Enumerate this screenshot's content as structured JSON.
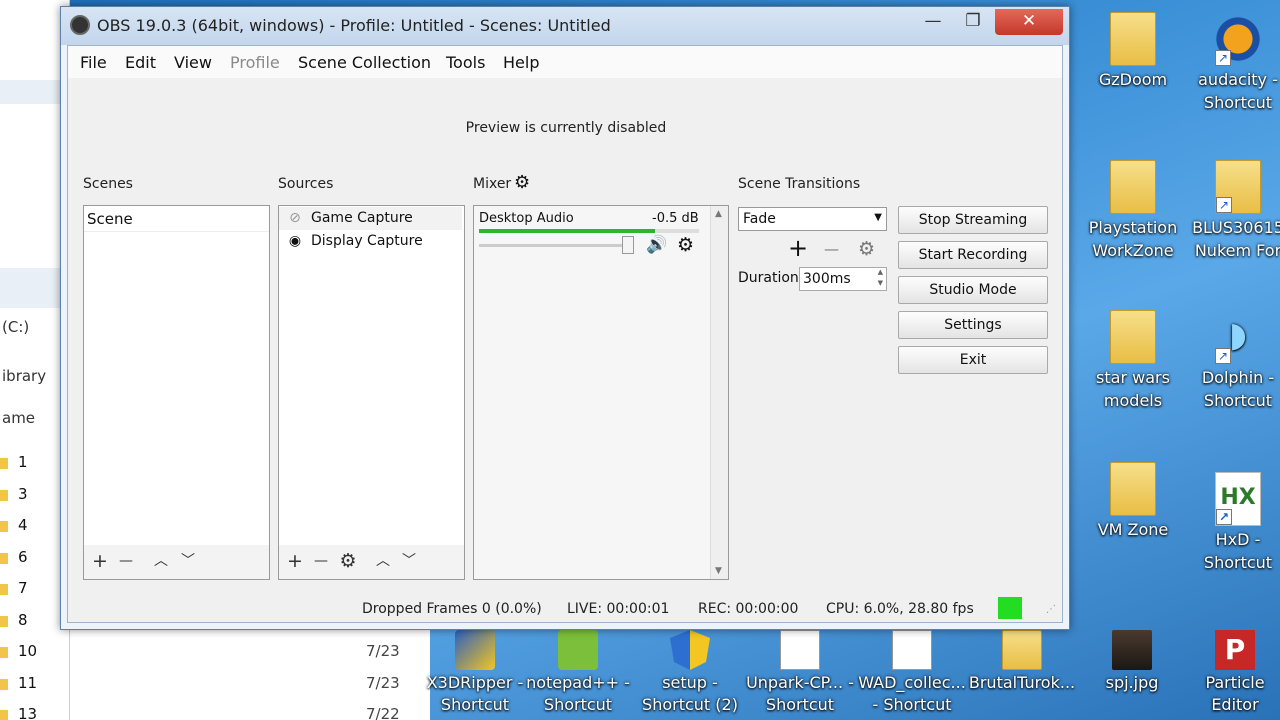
{
  "window": {
    "title": "OBS 19.0.3 (64bit, windows) - Profile: Untitled - Scenes: Untitled",
    "controls": {
      "minimize": "—",
      "maximize": "❐",
      "close": "✕"
    }
  },
  "menubar": {
    "items": [
      {
        "label": "File"
      },
      {
        "label": "Edit"
      },
      {
        "label": "View"
      },
      {
        "label": "Profile",
        "disabled": true
      },
      {
        "label": "Scene Collection"
      },
      {
        "label": "Tools"
      },
      {
        "label": "Help"
      }
    ]
  },
  "preview": {
    "message": "Preview is currently disabled"
  },
  "scenes": {
    "label": "Scenes",
    "items": [
      "Scene"
    ],
    "toolbar": {
      "add": "+",
      "remove": "—",
      "up": "︿",
      "down": "﹀"
    }
  },
  "sources": {
    "label": "Sources",
    "items": [
      {
        "name": "Game Capture",
        "visible": false
      },
      {
        "name": "Display Capture",
        "visible": true
      }
    ],
    "toolbar": {
      "add": "+",
      "remove": "—",
      "settings": "⚙",
      "up": "︿",
      "down": "﹀"
    }
  },
  "mixer": {
    "label": "Mixer",
    "channels": [
      {
        "name": "Desktop Audio",
        "level": "-0.5 dB",
        "meter_fill": 0.8,
        "volume": 0.96
      }
    ],
    "icons": {
      "gear": "⚙",
      "speaker": "🔊"
    }
  },
  "transitions": {
    "label": "Scene Transitions",
    "selected": "Fade",
    "duration_label": "Duration",
    "duration_value": "300ms",
    "icons": {
      "add": "+",
      "remove": "—",
      "gear": "⚙"
    }
  },
  "controls": {
    "stop_streaming": "Stop Streaming",
    "start_recording": "Start Recording",
    "studio_mode": "Studio Mode",
    "settings": "Settings",
    "exit": "Exit"
  },
  "status": {
    "dropped_frames": "Dropped Frames 0 (0.0%)",
    "live": "LIVE: 00:00:01",
    "rec": "REC: 00:00:00",
    "cpu": "CPU: 6.0%, 28.80 fps",
    "indicator_color": "#22dd22"
  },
  "desktop": {
    "icons": [
      {
        "label": "GzDoom",
        "type": "folder"
      },
      {
        "label": "audacity - Shortcut",
        "type": "shortcut"
      },
      {
        "label": "Playstation WorkZone",
        "type": "folder"
      },
      {
        "label": "BLUS30615 Nukem For",
        "type": "folder-shortcut"
      },
      {
        "label": "star wars models",
        "type": "folder"
      },
      {
        "label": "Dolphin - Shortcut",
        "type": "shortcut"
      },
      {
        "label": "VM Zone",
        "type": "folder"
      },
      {
        "label": "HxD - Shortcut",
        "type": "shortcut"
      }
    ],
    "bottom_icons": [
      {
        "label": "X3DRipper - Shortcut"
      },
      {
        "label": "notepad++ - Shortcut"
      },
      {
        "label": "setup - Shortcut (2)"
      },
      {
        "label": "Unpark-CP... - Shortcut"
      },
      {
        "label": "WAD_collec... - Shortcut"
      },
      {
        "label": "BrutalTurok..."
      },
      {
        "label": "spj.jpg"
      },
      {
        "label": "Particle Editor"
      }
    ]
  },
  "explorer": {
    "drive": "(C:)",
    "library": "ibrary",
    "name_col": "ame",
    "rows": [
      "1",
      "3",
      "4",
      "6",
      "7",
      "8",
      "10",
      "11",
      "13"
    ],
    "dates": [
      "7/23",
      "7/23",
      "7/22"
    ]
  }
}
